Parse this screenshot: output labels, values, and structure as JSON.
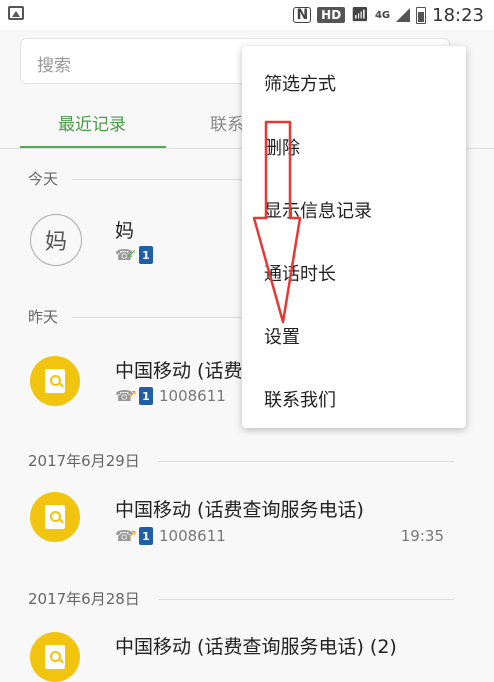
{
  "statusbar": {
    "icons": [
      "image-icon",
      "nfc-icon",
      "hd-icon",
      "wifi-icon",
      "4g-icon",
      "signal-icon",
      "battery-icon"
    ],
    "n_label": "N",
    "hd_label": "HD",
    "network": "4G",
    "time": "18:23"
  },
  "search": {
    "placeholder": "搜索"
  },
  "tabs": [
    {
      "label": "最近记录",
      "active": true
    },
    {
      "label": "联系",
      "active": false
    }
  ],
  "sections": {
    "today": "今天",
    "yesterday": "昨天",
    "date1": "2017年6月29日",
    "date2": "2017年6月28日"
  },
  "entries": [
    {
      "avatar_char": "妈",
      "name": "妈",
      "sim": "1",
      "call_type": "incoming",
      "number": "",
      "time": ""
    },
    {
      "name": "中国移动 (话费",
      "sim": "1",
      "call_type": "outgoing",
      "number": "1008611",
      "time": ""
    },
    {
      "name": "中国移动 (话费查询服务电话)",
      "sim": "1",
      "call_type": "outgoing",
      "number": "1008611",
      "time": "19:35"
    },
    {
      "name": "中国移动 (话费查询服务电话) (2)",
      "sim": "",
      "call_type": "",
      "number": "",
      "time": ""
    }
  ],
  "menu": {
    "items": [
      "筛选方式",
      "删除",
      "显示信息记录",
      "通话时长",
      "设置",
      "联系我们"
    ]
  },
  "colors": {
    "accent": "#4caf50",
    "sim_badge": "#1e5fa8",
    "avatar_yellow": "#f1c40f",
    "annotation_arrow": "#e53935"
  }
}
